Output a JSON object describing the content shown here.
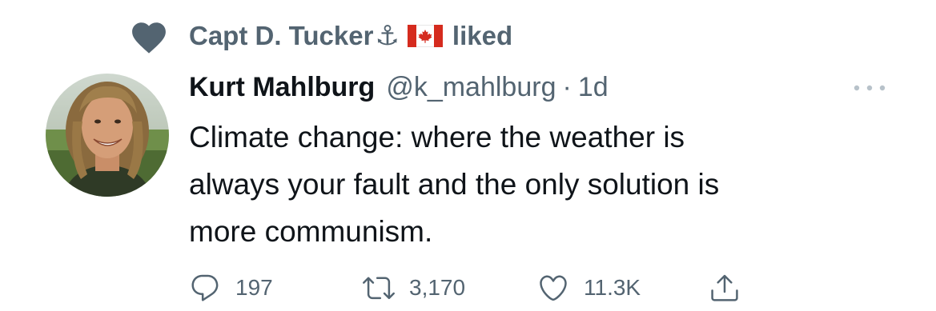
{
  "social_context": {
    "icon": "heart-icon",
    "user_name": "Capt D. Tucker",
    "name_emoji": "⚓",
    "flag": "canada-flag",
    "action": "liked"
  },
  "tweet": {
    "author": {
      "display_name": "Kurt Mahlburg",
      "handle": "@k_mahlburg",
      "separator": "·",
      "timestamp": "1d"
    },
    "text": "Climate change: where the weather is\nalways your fault and the only solution is\nmore communism.",
    "more_icon": "more-icon"
  },
  "actions": {
    "reply": {
      "icon": "reply-icon",
      "count": "197"
    },
    "retweet": {
      "icon": "retweet-icon",
      "count": "3,170"
    },
    "like": {
      "icon": "heart-outline-icon",
      "count": "11.3K"
    },
    "share": {
      "icon": "share-icon"
    }
  },
  "colors": {
    "primary_text": "#0f1419",
    "secondary_text": "#536471",
    "background": "#ffffff",
    "canada_red": "#d52b1e"
  }
}
